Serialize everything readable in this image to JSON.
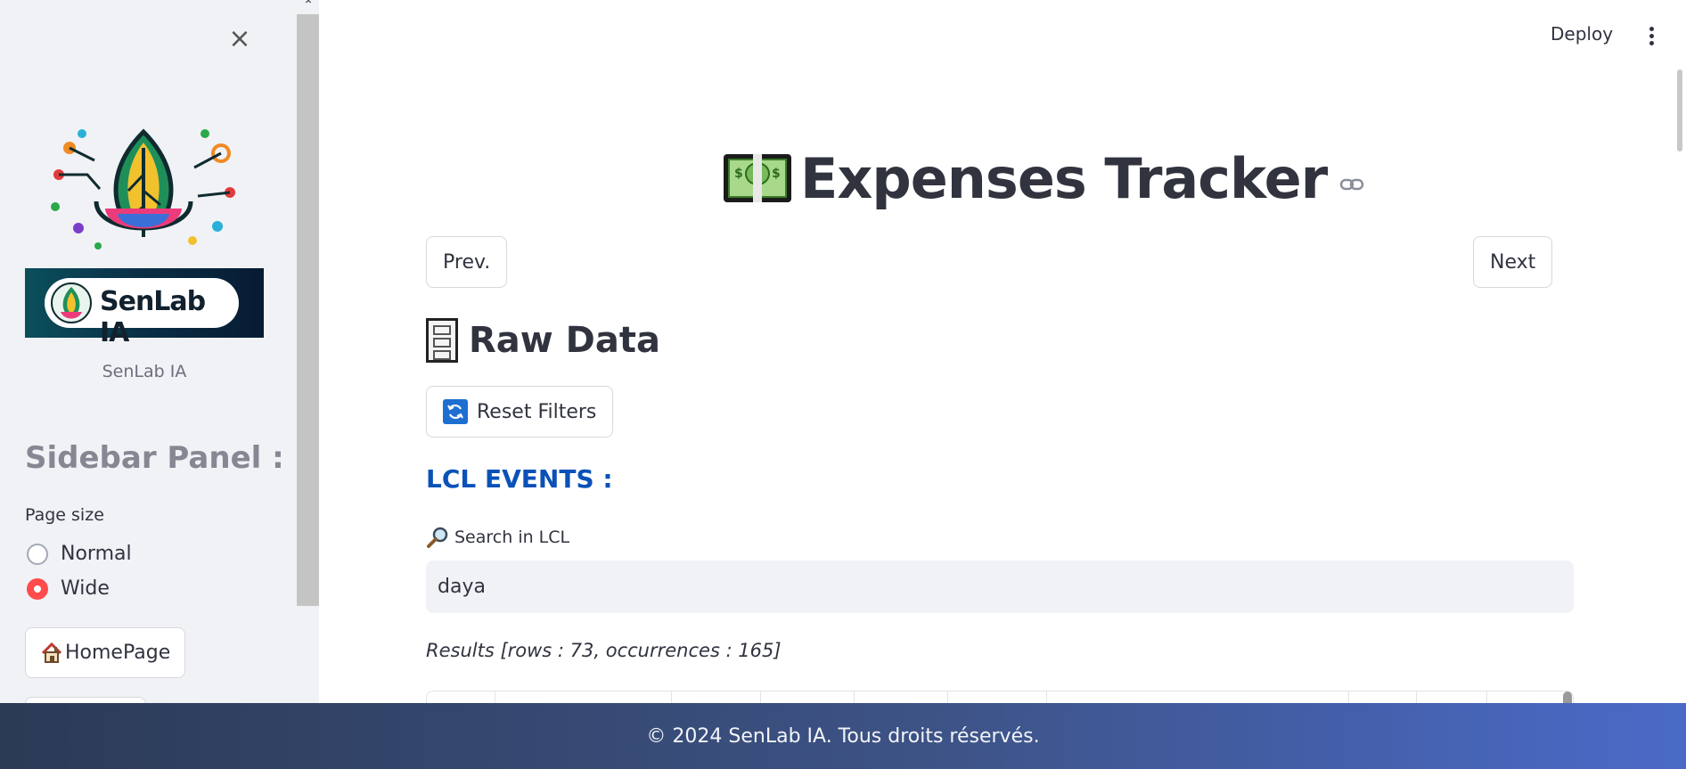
{
  "sidebar": {
    "close_icon": "close-icon",
    "logo_icon": "senlab-tree-logo",
    "banner_text": "SenLab IA",
    "caption": "SenLab IA",
    "header": "Sidebar Panel :",
    "page_size": {
      "label": "Page size",
      "options": [
        {
          "label": "Normal",
          "selected": false
        },
        {
          "label": "Wide",
          "selected": true
        }
      ]
    },
    "home_button": {
      "icon": "house-icon",
      "label": "HomePage"
    }
  },
  "topbar": {
    "deploy_label": "Deploy",
    "menu_icon": "kebab-menu-icon"
  },
  "main": {
    "title": "Expenses Tracker",
    "title_icon": "money-bill-icon",
    "anchor_icon": "link-icon",
    "prev_label": "Prev.",
    "next_label": "Next",
    "section_title": "Raw Data",
    "section_icon": "file-cabinet-icon",
    "reset_button": {
      "icon": "refresh-icon",
      "label": "Reset Filters"
    },
    "events_header": "LCL EVENTS :",
    "search": {
      "icon": "magnifier-icon",
      "label": "Search in LCL",
      "value": "daya"
    },
    "results_text": "Results [rows : 73, occurrences : 165]"
  },
  "footer": {
    "text": "© 2024 SenLab IA. Tous droits réservés."
  },
  "colors": {
    "accent_red": "#ff4b4b",
    "section_blue": "#0a51b8",
    "sidebar_bg": "#f0f2f6",
    "footer_start": "#2b3a55",
    "footer_end": "#4a6ac8"
  }
}
